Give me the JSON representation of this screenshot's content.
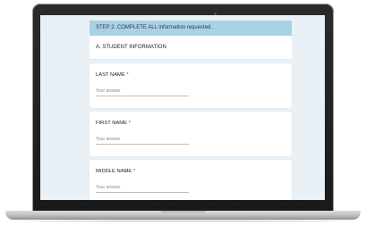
{
  "form": {
    "step_banner": "STEP 2. COMPLETE ALL information requested.",
    "section_title": "A. STUDENT INFORMATION",
    "required_marker": "*",
    "questions": [
      {
        "label": "LAST NAME",
        "placeholder": "Your answer"
      },
      {
        "label": "FIRST NAME",
        "placeholder": "Your answer"
      },
      {
        "label": "MIDDLE NAME",
        "placeholder": "Your answer"
      }
    ]
  },
  "colors": {
    "banner_bg": "#a9d3e4",
    "page_bg": "#e9f1f7",
    "required": "#d93025"
  }
}
